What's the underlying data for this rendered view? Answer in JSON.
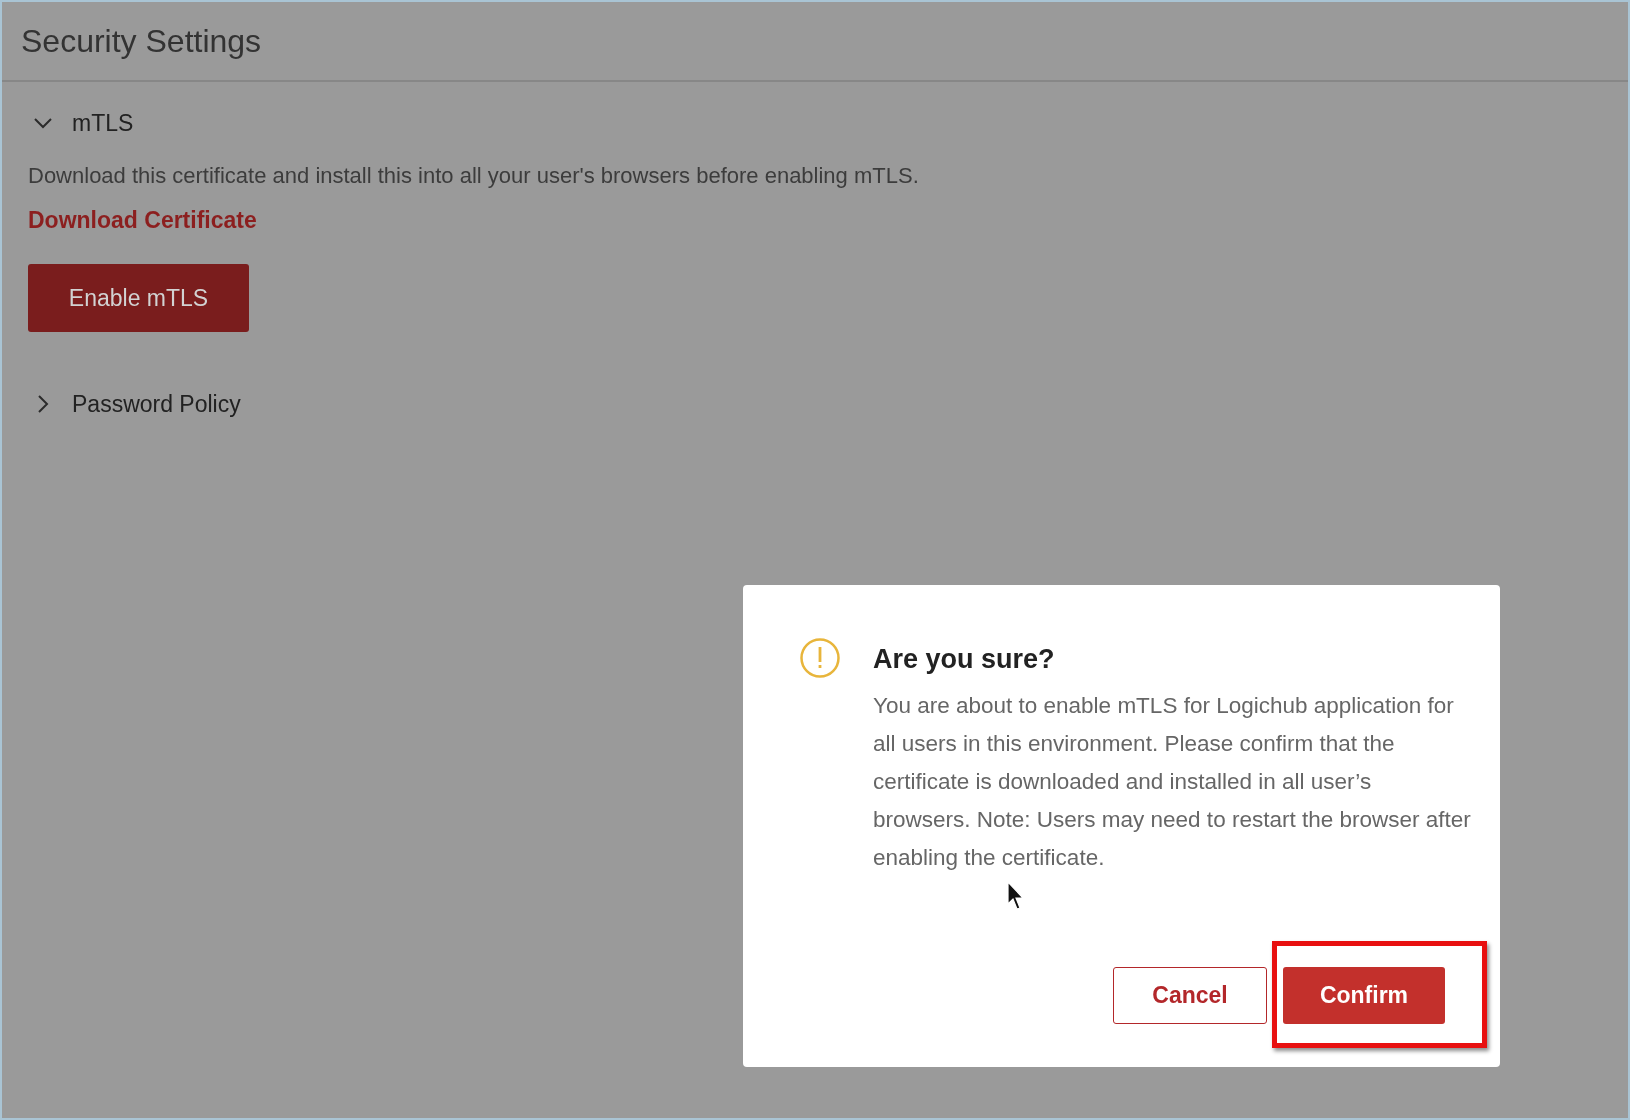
{
  "page": {
    "title": "Security Settings"
  },
  "sections": [
    {
      "title": "mTLS",
      "expanded": true,
      "description": "Download this certificate and install this into all your user's browsers before enabling mTLS.",
      "link": "Download Certificate",
      "button": "Enable mTLS"
    },
    {
      "title": "Password Policy",
      "expanded": false
    }
  ],
  "dialog": {
    "title": "Are you sure?",
    "message": "You are about to enable mTLS for Logichub application for all users in this environment. Please confirm that the certificate is downloaded and installed in all user’s browsers. Note: Users may need to restart the browser after enabling the certificate.",
    "buttons": [
      {
        "label": "Cancel",
        "kind": "secondary",
        "highlighted": false
      },
      {
        "label": "Confirm",
        "kind": "primary",
        "highlighted": true
      }
    ]
  }
}
